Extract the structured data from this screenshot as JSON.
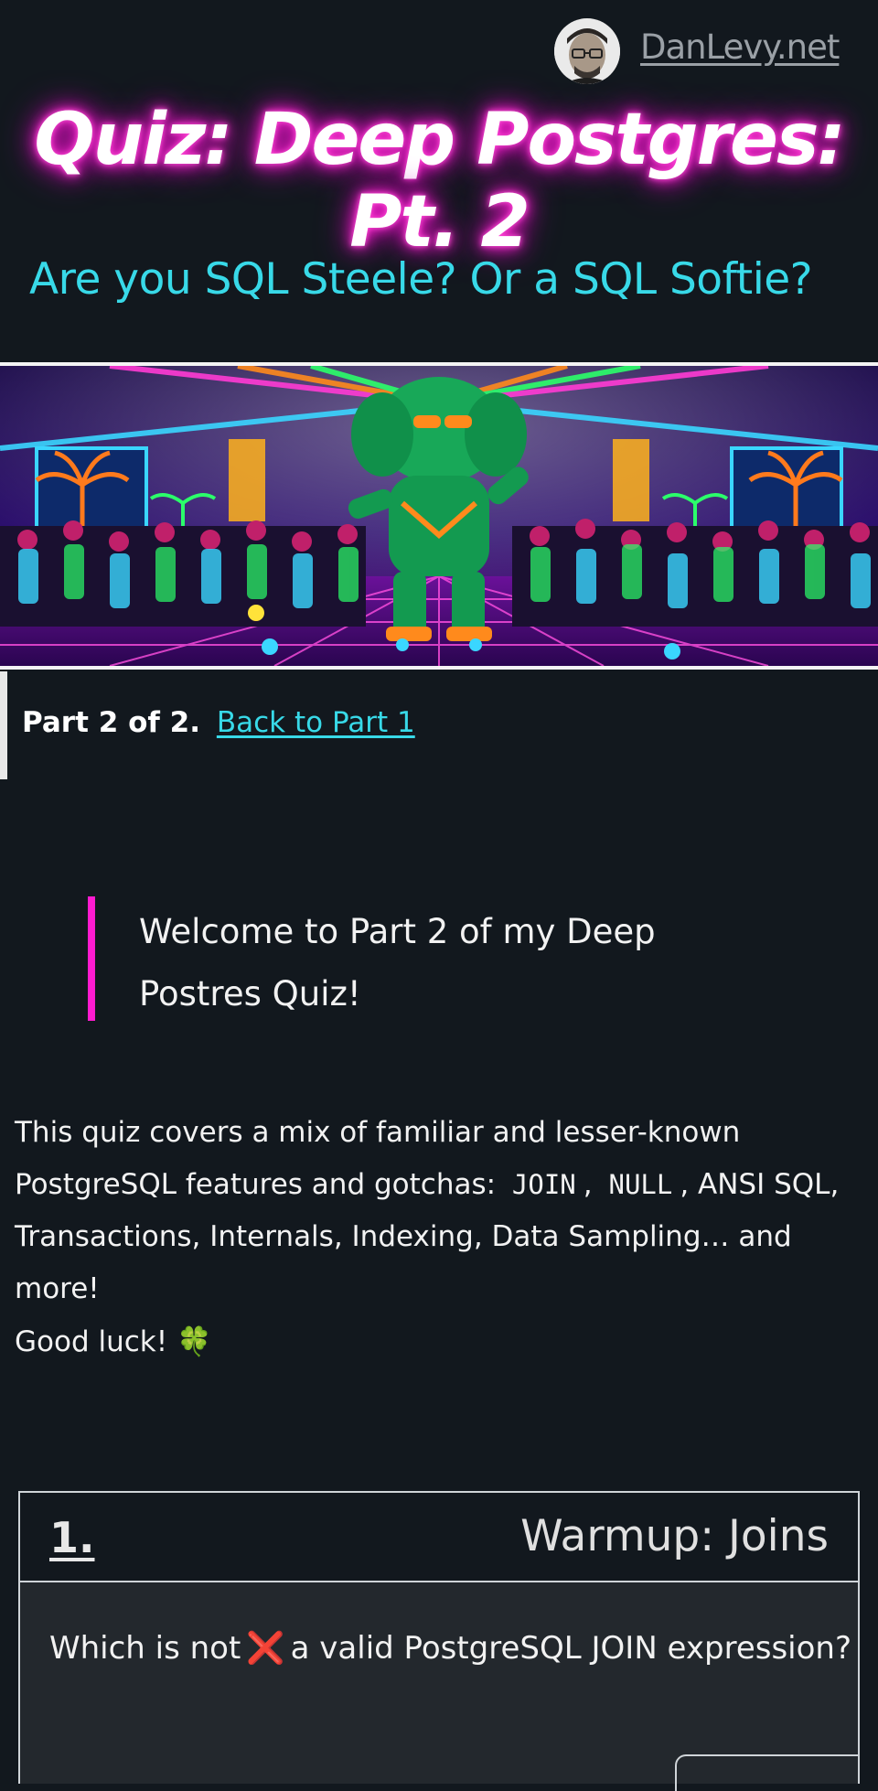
{
  "header": {
    "site_link": "DanLevy.net",
    "title": "Quiz: Deep Postgres: Pt. 2",
    "subtitle": "Are you SQL Steele? Or a SQL Softie?"
  },
  "hero": {
    "icon": "neon-elephant-disco-illustration"
  },
  "part_note": {
    "label": "Part 2 of 2.",
    "link": "Back to Part 1"
  },
  "welcome": {
    "line1": "Welcome to Part 2 of my Deep",
    "line2": "Postres Quiz!"
  },
  "intro": {
    "text_before": "This quiz covers a mix of familiar and lesser-known",
    "text_line2_start": "PostgreSQL features and gotchas:",
    "code1": "JOIN",
    "sep1": ",",
    "code2": "NULL",
    "text_after": ", ANSI SQL,",
    "line3": "Transactions, Internals, Indexing, Data Sampling… and more!"
  },
  "luck": {
    "text": "Good luck!",
    "emoji": "🍀"
  },
  "question": {
    "number": "1.",
    "category": "Warmup: Joins",
    "text_before": "Which is not",
    "mark": "❌",
    "text_after": "a valid PostgreSQL JOIN expression?"
  },
  "colors": {
    "background": "#12181e",
    "accent_cyan": "#38d9e8",
    "accent_pink": "#ff1bd0",
    "card_body": "#23282d"
  }
}
